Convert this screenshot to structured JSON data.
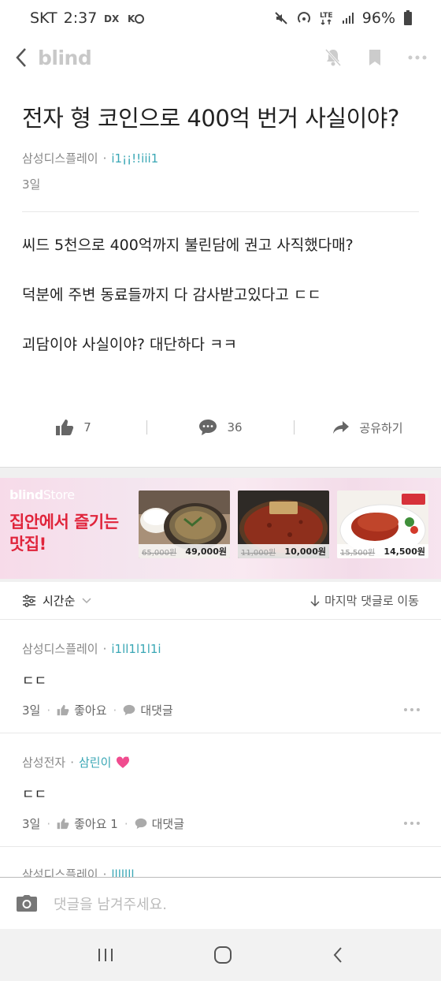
{
  "status_bar": {
    "carrier": "SKT",
    "time": "2:37",
    "battery": "96%",
    "network": "LTE"
  },
  "app_bar": {
    "logo": "blind"
  },
  "post": {
    "title": "전자 형 코인으로 400억 번거 사실이야?",
    "company": "삼성디스플레이",
    "separator": "·",
    "nickname": "i1¡¡!!iii1",
    "date": "3일",
    "body": [
      "씨드 5천으로 400억까지 불린담에 권고 사직했다매?",
      "덕분에 주변 동료들까지 다 감사받고있다고 ㄷㄷ",
      "괴담이야 사실이야?  대단하다 ㅋㅋ"
    ],
    "like_count": "7",
    "comment_count": "36",
    "share_label": "공유하기"
  },
  "banner": {
    "brand": "blind",
    "store": "Store",
    "headline_1": "집안에서 즐기는",
    "headline_2": "맛집!",
    "products": [
      {
        "old_price": "65,000원",
        "price": "49,000원"
      },
      {
        "old_price": "11,000원",
        "price": "10,000원"
      },
      {
        "old_price": "15,500원",
        "price": "14,500원"
      }
    ]
  },
  "sort_bar": {
    "sort_label": "시간순",
    "jump_label": "마지막 댓글로 이동"
  },
  "comments": [
    {
      "company": "삼성디스플레이",
      "nickname": "i1ll1l1l1i",
      "text": "ㄷㄷ",
      "date": "3일",
      "like_label": "좋아요",
      "reply_label": "대댓글"
    },
    {
      "company": "삼성전자",
      "nickname": "삼린이",
      "text": "ㄷㄷ",
      "date": "3일",
      "like_label": "좋아요 1",
      "reply_label": "대댓글"
    },
    {
      "company": "삼성디스플레이",
      "nickname": "lllllll"
    }
  ],
  "comment_input": {
    "placeholder": "댓글을 남겨주세요."
  },
  "colors": {
    "accent": "#3aa7b5",
    "banner_red": "#e0243b",
    "icon_gray": "#bbbbbb"
  }
}
